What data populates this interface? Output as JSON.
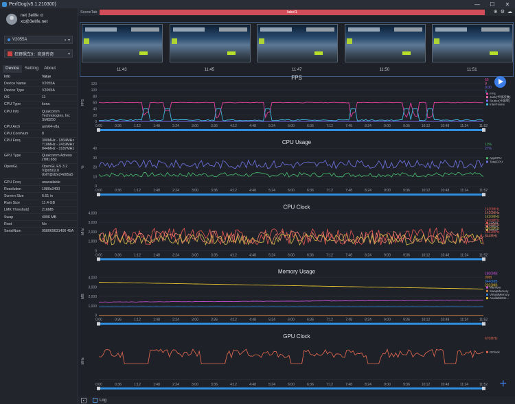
{
  "app": {
    "title": "PerfDog(v5.1.210300)"
  },
  "window_buttons": [
    "—",
    "☐",
    "✕"
  ],
  "profile": {
    "name": "net 3elife ⊙",
    "email": "xc@3elife.net"
  },
  "device_select": {
    "value": "V2055A",
    "badge": "◐ ▾"
  },
  "app_select": {
    "value": "狂野飙车9：竞速传奇"
  },
  "tabs": [
    "Device",
    "Setting",
    "About"
  ],
  "info": {
    "header": {
      "k": "Info",
      "v": "Value"
    },
    "rows": [
      {
        "k": "Device Name",
        "v": "V2055A"
      },
      {
        "k": "Device Type",
        "v": "V2055A"
      },
      {
        "k": "OS",
        "v": "11"
      },
      {
        "k": "CPU Type",
        "v": "kona"
      },
      {
        "k": "CPU Info",
        "v": "Qualcomm Technologies, Inc SM8250"
      },
      {
        "k": "CPU Arch",
        "v": "arm64-v8a"
      },
      {
        "k": "CPU CoreNum",
        "v": "8"
      },
      {
        "k": "CPU Freq",
        "v": "300MHz - 1804MHz 710MHz - 2419MHz 844MHz - 3187MHz"
      },
      {
        "k": "GPU Type",
        "v": "Qualcomm Adreno (TM) 650"
      },
      {
        "k": "OpenGL",
        "v": "OpenGL ES 3.2 V@0502.0 (GIT@d2e24d95a5"
      },
      {
        "k": "GPU Freq",
        "v": "unavailable"
      },
      {
        "k": "Resolution",
        "v": "1080x2400"
      },
      {
        "k": "Screen Size",
        "v": "6.61 in"
      },
      {
        "k": "Ram Size",
        "v": "11.4 GB"
      },
      {
        "k": "LMK Threshold",
        "v": "216MB"
      },
      {
        "k": "Swap",
        "v": "4096 MB"
      },
      {
        "k": "Root",
        "v": "No"
      },
      {
        "k": "SerialNum",
        "v": "958069631400 45A"
      }
    ]
  },
  "scene": {
    "tab_label": "SceneTab",
    "label": "label1"
  },
  "toolbar_icons": [
    "gear-icon",
    "settings-icon",
    "cloud-icon"
  ],
  "thumbnails": [
    {
      "time": "11:43"
    },
    {
      "time": "11:45"
    },
    {
      "time": "11:47"
    },
    {
      "time": "11:50"
    },
    {
      "time": "11:51"
    }
  ],
  "x_ticks": [
    "0:00",
    "0:36",
    "1:12",
    "1:48",
    "2:24",
    "3:00",
    "3:36",
    "4:12",
    "4:48",
    "5:24",
    "6:00",
    "6:36",
    "7:12",
    "7:48",
    "8:24",
    "9:00",
    "9:36",
    "10:12",
    "10:48",
    "11:24",
    "11:52"
  ],
  "bottom": {
    "log_label": "Log",
    "hint": "◂ ▸"
  },
  "colors": {
    "accent": "#3c7ce6",
    "label": "#d14d5a"
  },
  "chart_data": [
    {
      "type": "line",
      "title": "FPS",
      "ylabel": "FPS",
      "ylim": [
        0,
        120
      ],
      "yticks": [
        "0",
        "20",
        "40",
        "60",
        "80",
        "100",
        "120"
      ],
      "legend_values": [
        "60",
        "0",
        "0.00",
        "0"
      ],
      "series": [
        {
          "name": "FPS",
          "color": "#e040a0",
          "baseline": 60,
          "noise": 1,
          "spike_to": 4,
          "seed": 11
        },
        {
          "name": "Jank(卡顿次数)",
          "color": "#ff6fb0",
          "baseline": 0,
          "noise": 0,
          "spike_to": 0,
          "seed": 3
        },
        {
          "name": "Stutter(卡顿率)",
          "color": "#7b68ee",
          "baseline": 0,
          "noise": 0,
          "spike_to": 0,
          "seed": 5
        },
        {
          "name": "InterFrame",
          "color": "#3fb8e0",
          "baseline": 4,
          "noise": 2,
          "spike_to": 40,
          "seed": 21
        }
      ],
      "spike_points": [
        0.12,
        0.18,
        0.31,
        0.44,
        0.66,
        0.8,
        0.82,
        0.86
      ]
    },
    {
      "type": "line",
      "title": "CPU Usage",
      "ylabel": "%",
      "ylim": [
        0,
        40
      ],
      "yticks": [
        "0",
        "10",
        "20",
        "30",
        "40"
      ],
      "legend_values": [
        "13%",
        "27%"
      ],
      "series": [
        {
          "name": "AppCPU",
          "color": "#46b36b",
          "baseline": 12,
          "noise": 2.5,
          "seed": 7
        },
        {
          "name": "TotalCPU",
          "color": "#6b6fd8",
          "baseline": 23,
          "noise": 4.5,
          "seed": 9
        }
      ]
    },
    {
      "type": "line",
      "title": "CPU Clock",
      "ylabel": "MHz",
      "ylim": [
        0,
        4000
      ],
      "yticks": [
        "0",
        "1,000",
        "2,000",
        "3,000",
        "4,000"
      ],
      "legend_values": [
        "1420MHz",
        "1420MHz",
        "1420MHz",
        "1420MHz",
        "1862MHz",
        "1862MHz",
        "1862MHz",
        "844MHz"
      ],
      "series": [
        {
          "name": "CPU0",
          "color": "#d9534f",
          "baseline": 1500,
          "noise": 900,
          "seed": 31
        },
        {
          "name": "CPU4",
          "color": "#e07b6a",
          "baseline": 1400,
          "noise": 700,
          "seed": 33
        },
        {
          "name": "CPU7",
          "color": "#c9b04a",
          "baseline": 1200,
          "noise": 600,
          "seed": 35
        }
      ]
    },
    {
      "type": "line",
      "title": "Memory Usage",
      "ylabel": "MB",
      "ylim": [
        0,
        4000
      ],
      "yticks": [
        "0",
        "1,000",
        "2,000",
        "3,000",
        "4,000"
      ],
      "legend_values": [
        "1800MB",
        "9MB",
        "9440MB",
        "2023MB"
      ],
      "series": [
        {
          "name": "Memory",
          "color": "#c050d0",
          "baseline": 1600,
          "noise": 40,
          "seed": 41
        },
        {
          "name": "SwapMemory",
          "color": "#d08040",
          "baseline": 9,
          "noise": 0,
          "seed": 43
        },
        {
          "name": "VirtualMemory",
          "color": "#3080e0",
          "baseline": 900,
          "noise": 10,
          "seed": 45
        },
        {
          "name": "AvailableMe...",
          "color": "#e0c030",
          "baseline": 3500,
          "noise": 30,
          "seed": 47
        }
      ]
    },
    {
      "type": "line",
      "title": "GPU Clock",
      "ylabel": "MHz",
      "ylim": [
        0,
        800
      ],
      "yticks": [],
      "legend_values": [
        "670MHz"
      ],
      "series": [
        {
          "name": "GClock",
          "color": "#d8644e",
          "baseline": 560,
          "noise": 90,
          "seed": 51
        }
      ]
    }
  ]
}
